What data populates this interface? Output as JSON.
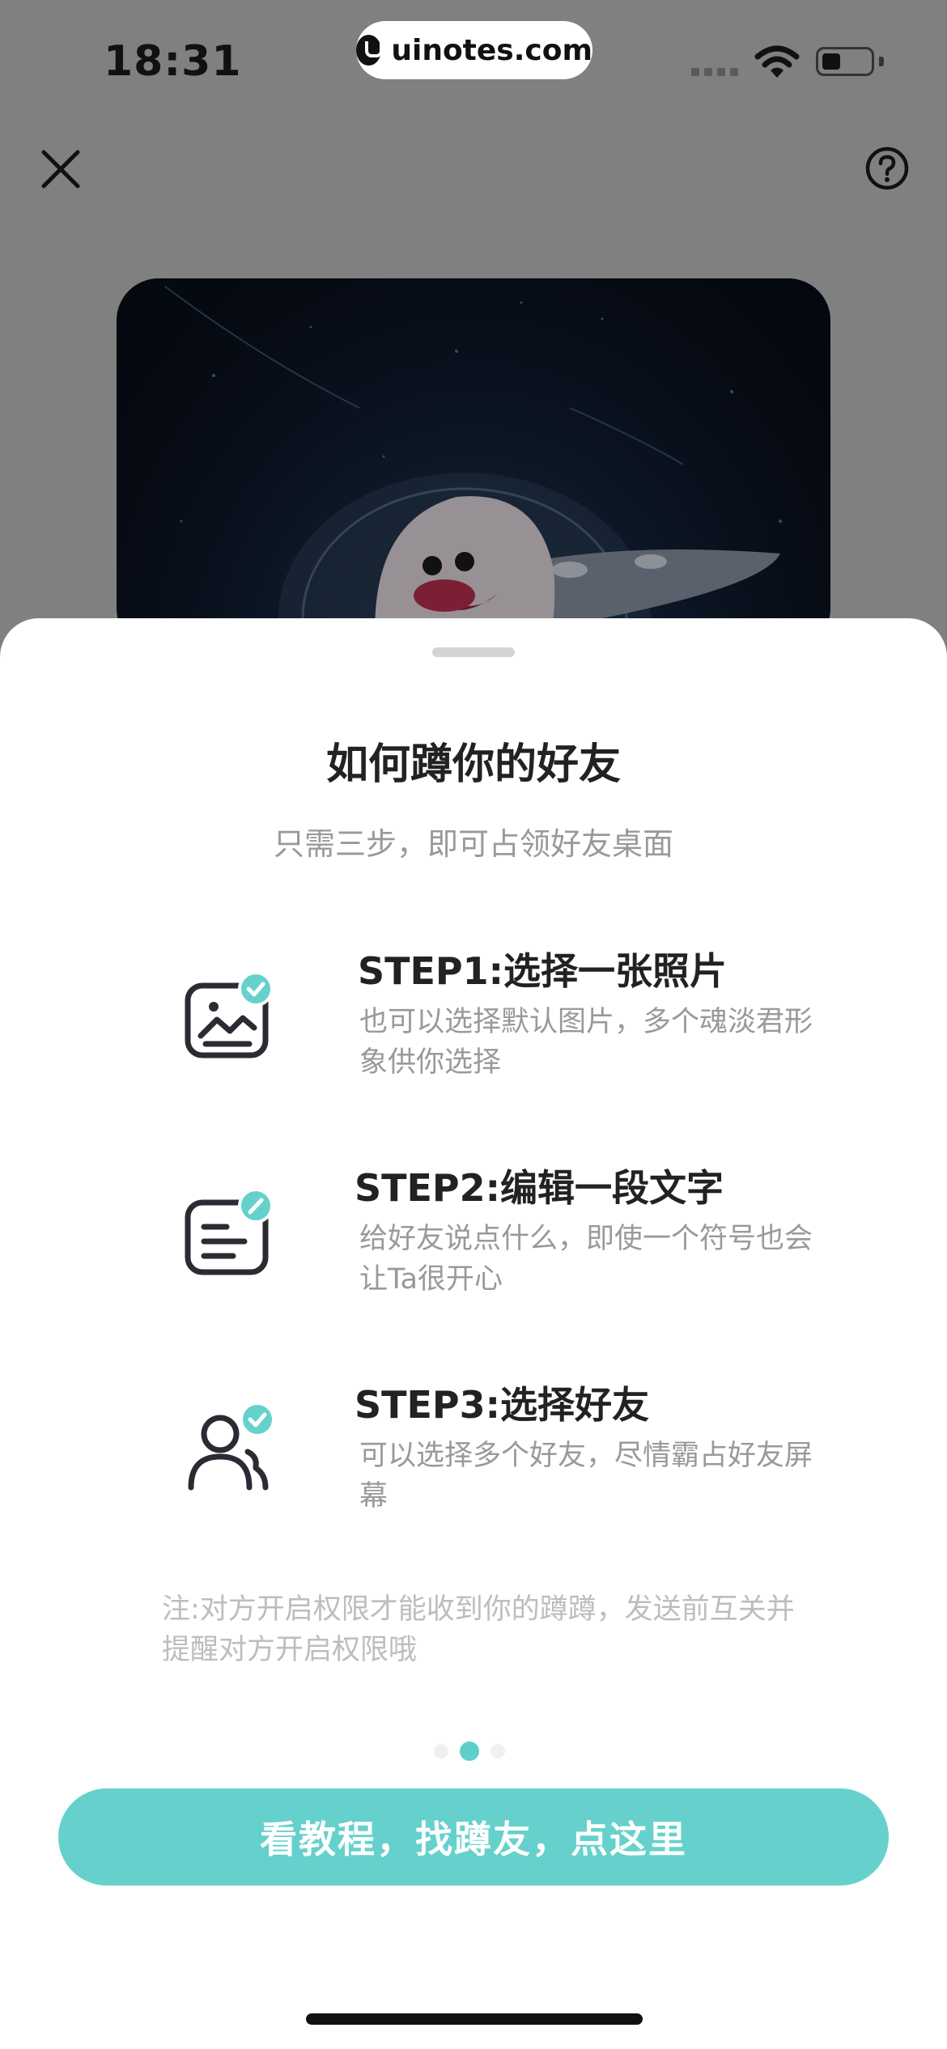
{
  "status_bar": {
    "time": "18:31",
    "url": "uinotes.com"
  },
  "header": {
    "close_icon": "close-icon",
    "help_icon": "help-icon"
  },
  "sheet": {
    "title": "如何蹲你的好友",
    "subtitle": "只需三步，即可占领好友桌面",
    "steps": [
      {
        "title": "STEP1:选择一张照片",
        "desc": "也可以选择默认图片，多个魂淡君形象供你选择",
        "icon": "image-check-icon"
      },
      {
        "title": "STEP2:编辑一段文字",
        "desc": "给好友说点什么，即使一个符号也会让Ta很开心",
        "icon": "text-edit-icon"
      },
      {
        "title": "STEP3:选择好友",
        "desc": "可以选择多个好友，尽情霸占好友屏幕",
        "icon": "friends-check-icon"
      }
    ],
    "note": "注:对方开启权限才能收到你的蹲蹲，发送前互关并提醒对方开启权限哦",
    "pager": {
      "total": 3,
      "active_index": 1
    },
    "cta_label": "看教程，找蹲友，点这里"
  },
  "colors": {
    "accent": "#66d1cc",
    "overlay": "#808080",
    "icon_dark": "#2b2b33"
  }
}
